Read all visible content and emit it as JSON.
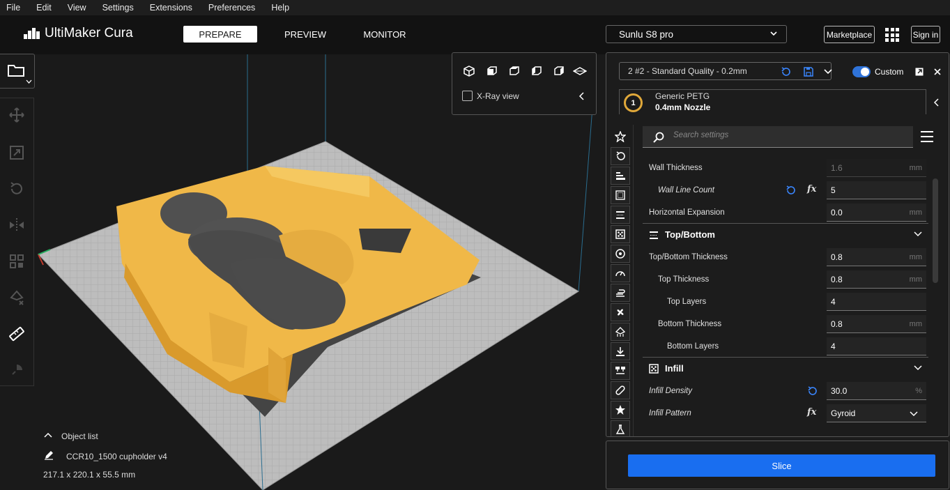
{
  "menu": [
    "File",
    "Edit",
    "View",
    "Settings",
    "Extensions",
    "Preferences",
    "Help"
  ],
  "header": {
    "app_title": "UltiMaker Cura",
    "stages": [
      "PREPARE",
      "PREVIEW",
      "MONITOR"
    ],
    "active_stage": "PREPARE",
    "printer": "Sunlu S8 pro",
    "marketplace_label": "Marketplace",
    "signin_label": "Sign in"
  },
  "view_panel": {
    "xray_label": "X-Ray view"
  },
  "object_list": {
    "title": "Object list",
    "object_name": "CCR10_1500 cupholder v4",
    "dimensions": "217.1 x 220.1 x 55.5 mm"
  },
  "settings": {
    "profile": "2 #2 - Standard Quality - 0.2mm",
    "mode_label": "Custom",
    "extruder": {
      "number": "1",
      "material": "Generic PETG",
      "nozzle": "0.4mm Nozzle",
      "color": "#e0a83a"
    },
    "search_placeholder": "Search settings",
    "rows": {
      "wall_thickness": {
        "label": "Wall Thickness",
        "value": "1.6",
        "unit": "mm"
      },
      "wall_line_count": {
        "label": "Wall Line Count",
        "value": "5"
      },
      "horizontal_expansion": {
        "label": "Horizontal Expansion",
        "value": "0.0",
        "unit": "mm"
      },
      "topbottom_thickness": {
        "label": "Top/Bottom Thickness",
        "value": "0.8",
        "unit": "mm"
      },
      "top_thickness": {
        "label": "Top Thickness",
        "value": "0.8",
        "unit": "mm"
      },
      "top_layers": {
        "label": "Top Layers",
        "value": "4"
      },
      "bottom_thickness": {
        "label": "Bottom Thickness",
        "value": "0.8",
        "unit": "mm"
      },
      "bottom_layers": {
        "label": "Bottom Layers",
        "value": "4"
      },
      "infill_density": {
        "label": "Infill Density",
        "value": "30.0",
        "unit": "%"
      },
      "infill_pattern": {
        "label": "Infill Pattern",
        "value": "Gyroid"
      }
    },
    "categories": {
      "topbottom": "Top/Bottom",
      "infill": "Infill"
    },
    "fx_symbol": "fx"
  },
  "slice": {
    "label": "Slice"
  },
  "colors": {
    "accent": "#196ef0",
    "model": "#f5c05a",
    "buildplate": "#b9b9b9"
  }
}
